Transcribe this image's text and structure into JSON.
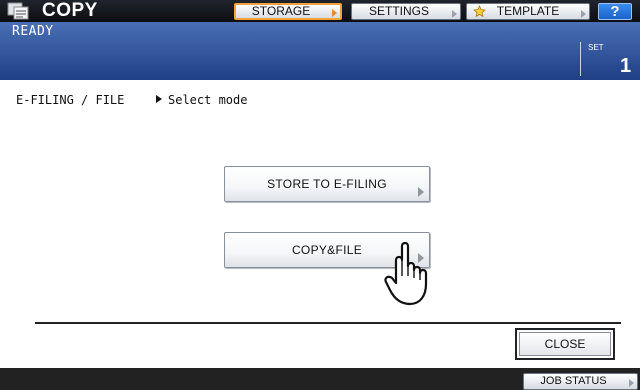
{
  "header": {
    "title": "COPY",
    "mode_icon": "copier-icon",
    "tabs": [
      {
        "label": "STORAGE",
        "active": true
      },
      {
        "label": "SETTINGS",
        "active": false
      },
      {
        "label": "TEMPLATE",
        "active": false,
        "icon": "star-icon"
      }
    ],
    "help_label": "?"
  },
  "status": {
    "message": "READY",
    "set_label": "SET",
    "set_count": "1"
  },
  "main": {
    "breadcrumb_path": "E-FILING / FILE",
    "breadcrumb_instruction": "Select mode",
    "buttons": [
      {
        "label": "STORE TO E-FILING"
      },
      {
        "label": "COPY&FILE"
      }
    ],
    "pointer_icon": "pointing-hand-icon"
  },
  "footer": {
    "close_label": "CLOSE",
    "job_status_label": "JOB STATUS"
  },
  "colors": {
    "active_tab_border": "#f2a23a",
    "status_bar": "#2f55a0",
    "help_button": "#2a78e0"
  }
}
